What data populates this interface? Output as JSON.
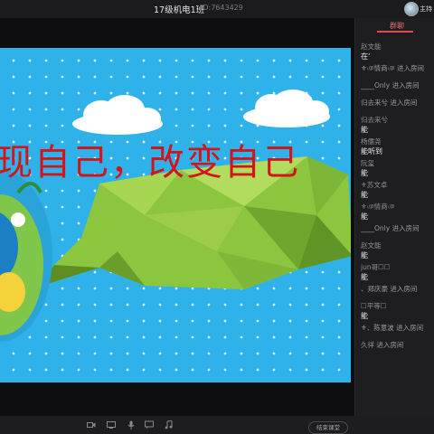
{
  "window": {
    "title": "17级机电1班",
    "room_id": "ID:7643429",
    "host_label": "主持"
  },
  "slide": {
    "headline": "现自己，改变自己",
    "colors": {
      "sky": "#2fb2ea",
      "text": "#d3141b",
      "banner": "#8cc63f"
    }
  },
  "chat": {
    "tab_label": "群聊",
    "messages": [
      {
        "name": "赵文能",
        "text": "在‘"
      },
      {
        "event": "⚜ঞ情商ঞ 进入房间"
      },
      {
        "event": "____Only 进入房间"
      },
      {
        "event": "归去来兮 进入房间"
      },
      {
        "name": "归去来兮",
        "text": "能"
      },
      {
        "name": "杨儒尧",
        "text": "能听到"
      },
      {
        "name": "阮玺",
        "text": "能"
      },
      {
        "name": "⚜苏文卓",
        "text": "能"
      },
      {
        "name": "⚜ঞ情商ঞ",
        "text": "能"
      },
      {
        "event": "____Only 进入房间"
      },
      {
        "name": "赵文能",
        "text": "能"
      },
      {
        "name": "jun哥☐☐",
        "text": "能"
      },
      {
        "event": "、郑庆豪 进入房间"
      },
      {
        "name": "☐平等☐",
        "text": "能"
      },
      {
        "event": "⚜、陈意波 进入房间"
      },
      {
        "event": "久徉 进入房间"
      }
    ]
  },
  "toolbar": {
    "icons": [
      "camera-icon",
      "screen-share-icon",
      "microphone-icon",
      "chat-bubble-icon",
      "music-icon"
    ],
    "end_button": "结束课堂"
  }
}
